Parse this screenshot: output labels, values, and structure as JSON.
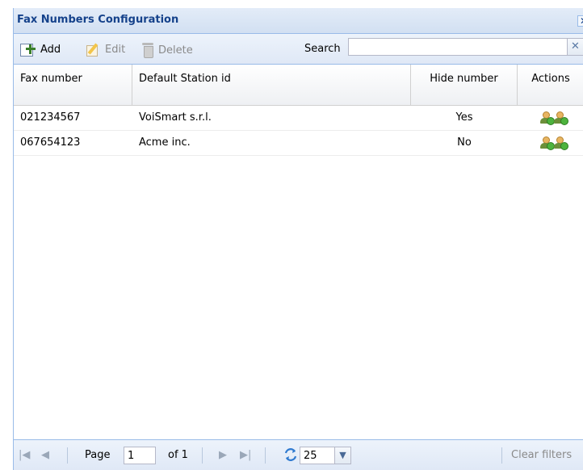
{
  "window": {
    "title": "Fax Numbers Configuration",
    "close_glyph": "✕"
  },
  "toolbar": {
    "add_label": "Add",
    "edit_label": "Edit",
    "delete_label": "Delete",
    "search_label": "Search",
    "search_value": "",
    "search_clear_glyph": "✕"
  },
  "grid": {
    "columns": [
      "Fax number",
      "Default Station id",
      "Hide number",
      "Actions"
    ],
    "rows": [
      {
        "fax_number": "021234567",
        "station": "VoiSmart s.r.l.",
        "hide": "Yes"
      },
      {
        "fax_number": "067654123",
        "station": "Acme inc.",
        "hide": "No"
      }
    ],
    "action_icons": [
      "user-add-icon",
      "users-add-icon"
    ]
  },
  "pager": {
    "page_label": "Page",
    "page_value": "1",
    "of_label": "of 1",
    "page_size": "25",
    "clear_filters": "Clear filters"
  }
}
